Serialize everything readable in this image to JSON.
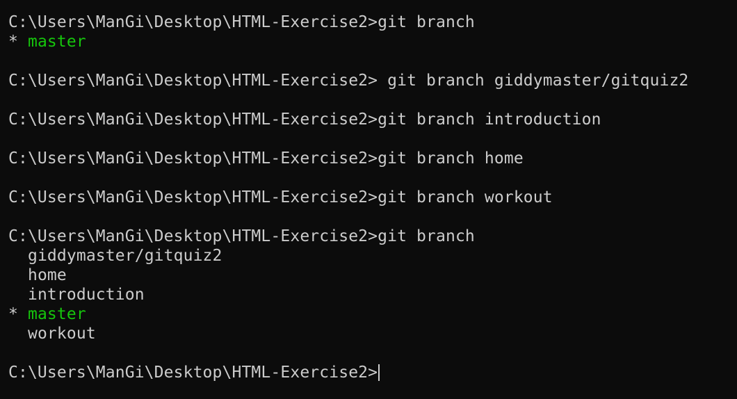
{
  "prompt": "C:\\Users\\ManGi\\Desktop\\HTML-Exercise2>",
  "commands": {
    "c1": "git branch",
    "c2": " git branch giddymaster/gitquiz2",
    "c3": "git branch introduction",
    "c4": "git branch home",
    "c5": "git branch workout",
    "c6": "git branch"
  },
  "output": {
    "star": "* ",
    "indent": "  ",
    "current_branch": "master",
    "branches_before": [
      "giddymaster/gitquiz2",
      "home",
      "introduction"
    ],
    "branches_after": [
      "workout"
    ]
  },
  "colors": {
    "background": "#0c0c0c",
    "text": "#cccccc",
    "current_branch": "#16c60c"
  }
}
